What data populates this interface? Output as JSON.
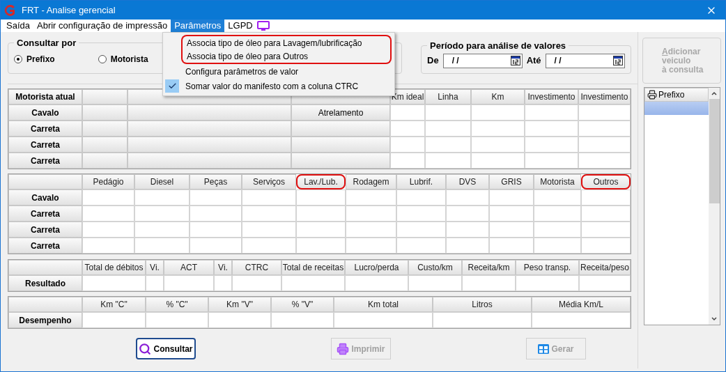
{
  "window": {
    "title": "FRT - Analise gerencial"
  },
  "menu": [
    {
      "label": "Saída",
      "selected": false,
      "kind": "text"
    },
    {
      "label": "Abrir configuração de impressão",
      "selected": false,
      "kind": "text"
    },
    {
      "label": "Parâmetros",
      "selected": true,
      "kind": "text"
    },
    {
      "label": "LGPD",
      "selected": false,
      "kind": "monitor"
    }
  ],
  "dropdown": [
    {
      "label": "Associa tipo de óleo para Lavagem/lubrificação",
      "checked": false,
      "highlighted": true
    },
    {
      "label": "Associa tipo de óleo para Outros",
      "checked": false,
      "highlighted": true
    },
    {
      "label": "Configura parâmetros de valor",
      "checked": false,
      "highlighted": false
    },
    {
      "label": "Somar valor do manifesto com a coluna CTRC",
      "checked": true,
      "highlighted": false
    }
  ],
  "consult_by": {
    "title": "Consultar por",
    "options": [
      {
        "label": "Prefixo",
        "selected": true
      },
      {
        "label": "Motorista",
        "selected": false
      }
    ]
  },
  "period": {
    "title": "Período para análise de valores",
    "from_label": "De",
    "from_value": "/ /",
    "to_label": "Até",
    "to_value": "/ /"
  },
  "add_button": {
    "lines": [
      "Adicionar",
      "veiculo",
      "à consulta"
    ],
    "disabled": true
  },
  "grids": [
    {
      "corner": "Motorista atual",
      "columns": [
        {
          "kind": "button"
        },
        {
          "kind": "button"
        },
        {
          "kind": "note"
        },
        {
          "label": "Km ideal"
        },
        {
          "label": "Linha"
        },
        {
          "label": "Km"
        },
        {
          "label": "Investimento"
        },
        {
          "label": "Investimento"
        }
      ],
      "rows": [
        {
          "label": "Cavalo",
          "note": "Atrelamento"
        },
        {
          "label": "Carreta"
        },
        {
          "label": "Carreta"
        },
        {
          "label": "Carreta"
        }
      ]
    },
    {
      "columns": [
        {
          "label": "Pedágio"
        },
        {
          "label": "Diesel"
        },
        {
          "label": "Peças"
        },
        {
          "label": "Serviços"
        },
        {
          "label": "Lav./Lub.",
          "highlighted": true
        },
        {
          "label": "Rodagem"
        },
        {
          "label": "Lubrif."
        },
        {
          "label": "DVS"
        },
        {
          "label": "GRIS"
        },
        {
          "label": "Motorista"
        },
        {
          "label": "Outros",
          "highlighted": true
        }
      ],
      "rows": [
        {
          "label": "Cavalo"
        },
        {
          "label": "Carreta"
        },
        {
          "label": "Carreta"
        },
        {
          "label": "Carreta"
        }
      ]
    },
    {
      "columns": [
        {
          "label": "Total de débitos"
        },
        {
          "label": "Vi."
        },
        {
          "label": "ACT"
        },
        {
          "label": "Vi."
        },
        {
          "label": "CTRC"
        },
        {
          "label": "Total de receitas"
        },
        {
          "label": "Lucro/perda"
        },
        {
          "label": "Custo/km"
        },
        {
          "label": "Receita/km"
        },
        {
          "label": "Peso transp."
        },
        {
          "label": "Receita/peso"
        }
      ],
      "rows": [
        {
          "label": "Resultado"
        }
      ]
    },
    {
      "columns": [
        {
          "label": "Km \"C\""
        },
        {
          "label": "% \"C\""
        },
        {
          "label": "Km \"V\""
        },
        {
          "label": "% \"V\""
        },
        {
          "label": "Km total"
        },
        {
          "label": "Litros"
        },
        {
          "label": "Média Km/L"
        }
      ],
      "rows": [
        {
          "label": "Desempenho"
        }
      ]
    }
  ],
  "list": {
    "header": "Prefixo",
    "rows": [
      {
        "selected": true
      }
    ]
  },
  "buttons": [
    {
      "label": "Consultar",
      "kind": "search",
      "disabled": false
    },
    {
      "label": "Imprimir",
      "kind": "print",
      "disabled": true
    },
    {
      "label": "Gerar",
      "kind": "table",
      "disabled": true
    }
  ]
}
